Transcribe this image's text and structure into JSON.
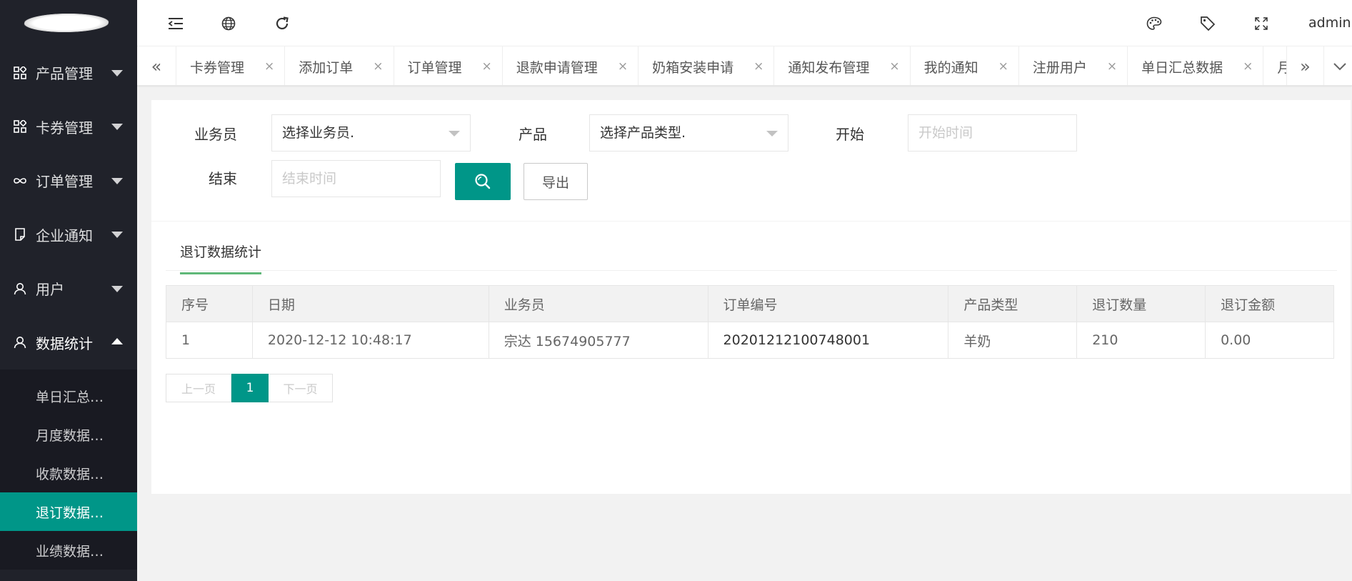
{
  "colors": {
    "sidebar_bg": "#20222a",
    "submenu_bg": "#191a22",
    "accent": "#009688",
    "tab_underline": "#5fb878"
  },
  "sidebar": {
    "menus": [
      {
        "label": "产品管理",
        "icon": "grid-icon",
        "expanded": false
      },
      {
        "label": "卡券管理",
        "icon": "grid-icon",
        "expanded": false
      },
      {
        "label": "订单管理",
        "icon": "infinity-icon",
        "expanded": false
      },
      {
        "label": "企业通知",
        "icon": "note-icon",
        "expanded": false
      },
      {
        "label": "用户",
        "icon": "user-icon",
        "expanded": false
      },
      {
        "label": "数据统计",
        "icon": "user-icon",
        "expanded": true
      }
    ],
    "submenu": [
      {
        "label": "单日汇总…",
        "active": false
      },
      {
        "label": "月度数据…",
        "active": false
      },
      {
        "label": "收款数据…",
        "active": false
      },
      {
        "label": "退订数据…",
        "active": true
      },
      {
        "label": "业绩数据…",
        "active": false
      }
    ]
  },
  "header": {
    "icons": [
      "collapse-menu-icon",
      "globe-icon",
      "refresh-icon",
      "palette-icon",
      "tag-icon",
      "fullscreen-icon"
    ],
    "user": "admin"
  },
  "tabs": {
    "items": [
      "卡券管理",
      "添加订单",
      "订单管理",
      "退款申请管理",
      "奶箱安装申请",
      "通知发布管理",
      "我的通知",
      "注册用户",
      "单日汇总数据",
      "月度数据"
    ],
    "close_glyph": "×",
    "left_arrow": "«",
    "right_arrow": "»"
  },
  "filters": {
    "salesman_label": "业务员",
    "salesman_value": "选择业务员.",
    "product_label": "产品",
    "product_value": "选择产品类型.",
    "start_label": "开始",
    "start_placeholder": "开始时间",
    "end_label": "结束",
    "end_placeholder": "结束时间",
    "export_label": "导出"
  },
  "section_title": "退订数据统计",
  "table": {
    "headers": [
      "序号",
      "日期",
      "业务员",
      "订单编号",
      "产品类型",
      "退订数量",
      "退订金额"
    ],
    "rows": [
      [
        "1",
        "2020-12-12 10:48:17",
        "宗达 15674905777",
        "20201212100748001",
        "羊奶",
        "210",
        "0.00"
      ]
    ]
  },
  "pagination": {
    "prev": "上一页",
    "current": "1",
    "next": "下一页"
  }
}
